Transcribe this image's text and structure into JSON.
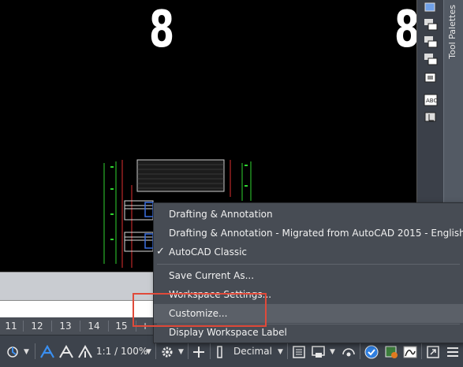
{
  "canvas": {
    "number_left": "8",
    "number_right": "8"
  },
  "palette": {
    "title": "Tool Palettes"
  },
  "layout_tabs": {
    "items": [
      "11",
      "12",
      "13",
      "14",
      "15",
      "+"
    ]
  },
  "status_bar": {
    "scale": "1:1 / 100%",
    "units": "Decimal"
  },
  "workspace_menu": {
    "items": [
      {
        "label": "Drafting & Annotation",
        "checked": false
      },
      {
        "label": "Drafting & Annotation - Migrated from AutoCAD 2015 - English",
        "checked": false
      },
      {
        "label": "AutoCAD Classic",
        "checked": true
      },
      {
        "label": "Save Current As...",
        "checked": false
      },
      {
        "label": "Workspace Settings...",
        "checked": false
      },
      {
        "label": "Customize...",
        "checked": false
      },
      {
        "label": "Display Workspace Label",
        "checked": false
      }
    ],
    "check_glyph": "✓"
  },
  "colors": {
    "highlight": "#e04a3a",
    "canvas": "#000000",
    "menu_bg": "#474c54",
    "accent_blue": "#2f7fe0"
  }
}
